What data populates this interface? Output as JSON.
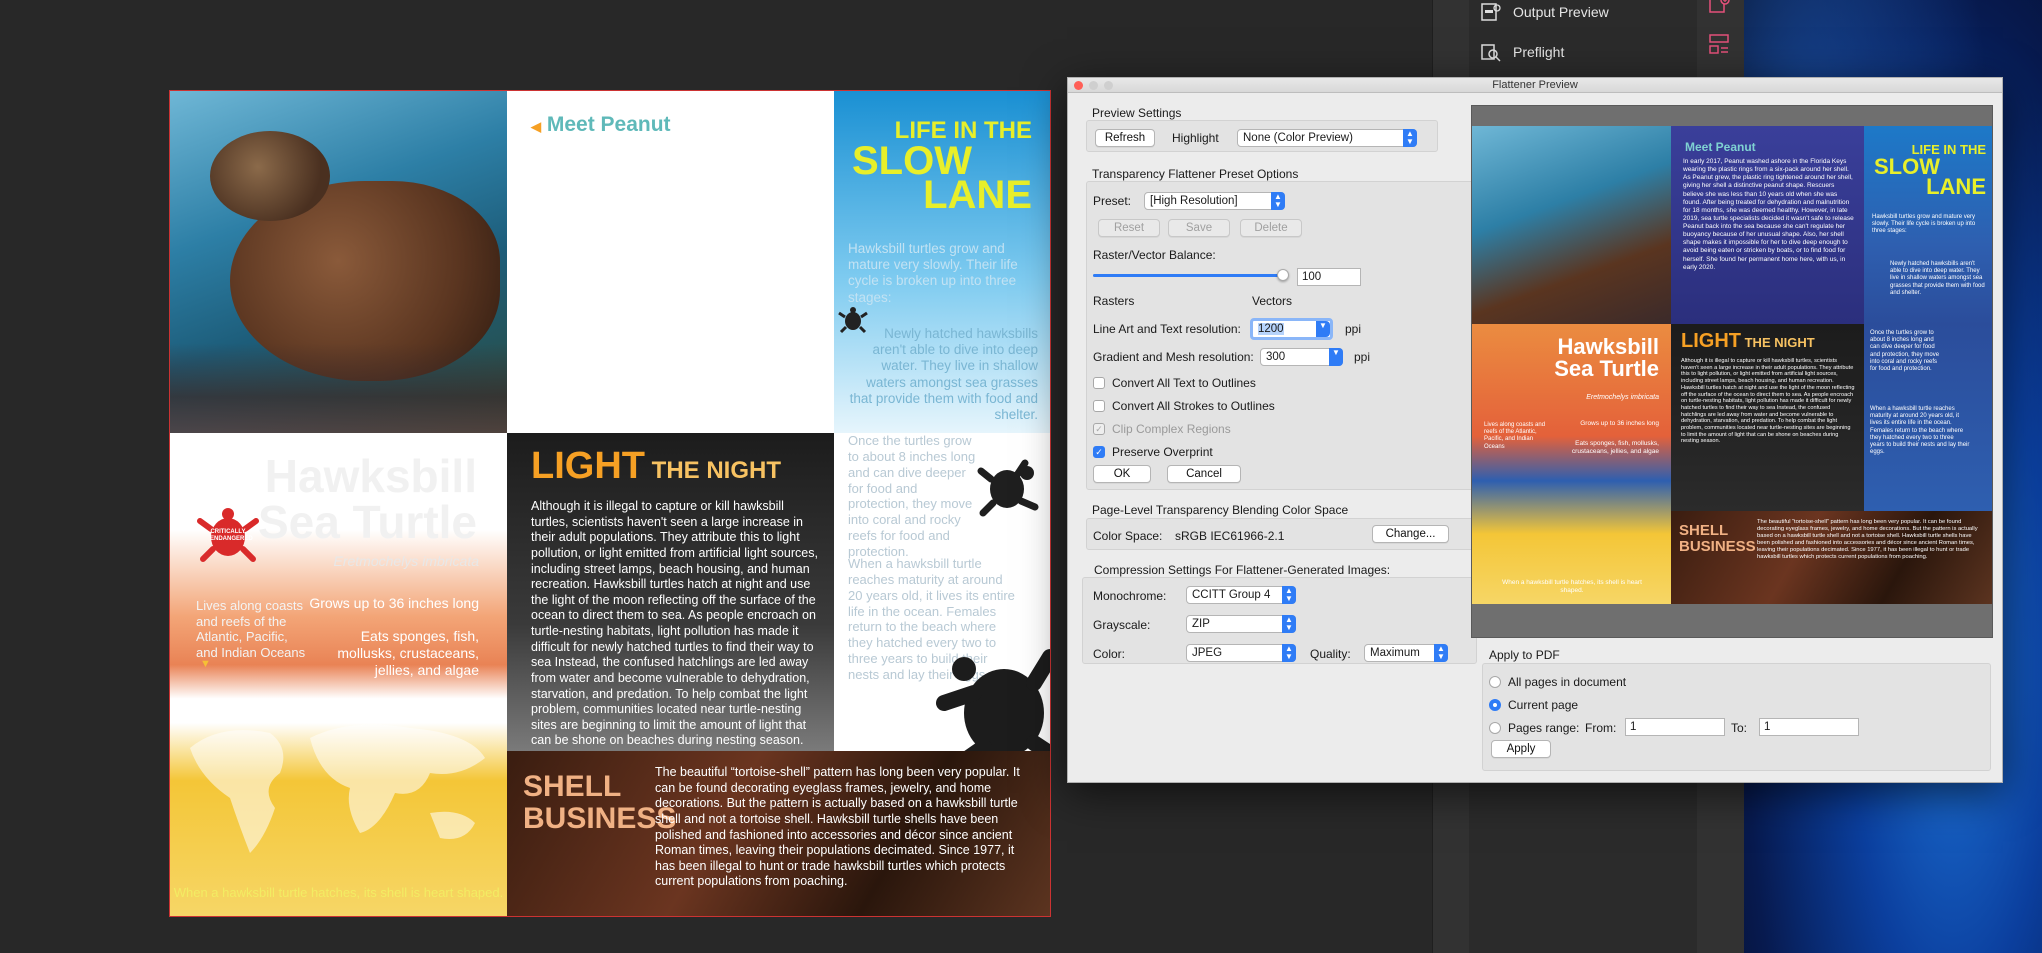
{
  "tools": {
    "output_preview": "Output Preview",
    "preflight": "Preflight"
  },
  "brochure": {
    "meet_peanut": "Meet Peanut",
    "slow_lane": {
      "line1": "LIFE IN THE",
      "line2": "SLOW",
      "line3": "LANE"
    },
    "slow_p1": "Hawksbill turtles grow and mature very slowly. Their life cycle is broken up into three stages:",
    "slow_p2": "Newly hatched hawksbills aren't able to dive into deep water. They live in shallow waters amongst sea grasses that provide them with food and shelter.",
    "hawksbill_title_1": "Hawksbill",
    "hawksbill_title_2": "Sea Turtle",
    "latin": "Eretmochelys imbricata",
    "critically": "CRITICALLY ENDANGERED",
    "fact_lives": "Lives along coasts and reefs of the Atlantic, Pacific, and Indian Oceans",
    "fact_grows": "Grows up to 36 inches long",
    "fact_eats": "Eats sponges, fish, mollusks, crustaceans, jellies, and algae",
    "hatches": "When a hawksbill turtle hatches, its shell is heart shaped.",
    "light_big": "LIGHT",
    "light_small": " THE NIGHT",
    "light_p": "Although it is illegal to capture or kill hawksbill turtles, scientists haven't seen a large increase in their adult populations. They attribute this to light pollution, or light emitted from artificial light sources, including street lamps, beach housing, and human recreation. Hawksbill turtles hatch at night and use the light of the moon reflecting off the surface of the ocean to direct them to sea. As people encroach on turtle-nesting habitats, light pollution has made it difficult for newly hatched turtles to find their way to sea Instead, the confused hatchlings are led away from water and become vulnerable to dehydration, starvation, and predation. To help combat the light problem, communities located near turtle-nesting sites are beginning to limit the amount of light that can be shone on beaches during nesting season.",
    "grow_p1": "Once the turtles grow to about 8 inches long and can dive deeper for food and protection, they move into coral and rocky reefs for food and protection.",
    "grow_p2": "When a hawksbill turtle reaches maturity at around 20 years old, it lives its entire life in the ocean. Females return to the beach where they hatched every two to three years to build their nests and lay their eggs.",
    "shell_h1": "SHELL",
    "shell_h2": "BUSINESS",
    "shell_p": "The beautiful “tortoise-shell” pattern has long been very popular. It can be found decorating eyeglass frames, jewelry, and home decorations. But the pattern is actually based on a hawksbill turtle shell and not a tortoise shell. Hawksbill turtle shells have been polished and fashioned into accessories and décor since ancient Roman times, leaving their populations decimated. Since 1977, it has been illegal to hunt or trade hawksbill turtles which protects current populations from poaching.",
    "peanut_story": "In early 2017, Peanut washed ashore in the Florida Keys wearing the plastic rings from a six-pack around her shell. As Peanut grew, the plastic ring tightened around her shell, giving her shell a distinctive peanut shape. Rescuers believe she was less than 10 years old when she was found. After being treated for dehydration and malnutrition for 18 months, she was deemed healthy. However, in late 2019, sea turtle specialists decided it wasn't safe to release Peanut back into the sea because she can't regulate her buoyancy because of her unusual shape. Also, her shell shape makes it impossible for her to dive deep enough to avoid being eaten or stricken by boats, or to find food for herself. She found her permanent home here, with us, in early 2020."
  },
  "dialog": {
    "title": "Flattener Preview",
    "preview_settings": "Preview Settings",
    "refresh": "Refresh",
    "highlight_label": "Highlight",
    "highlight_value": "None (Color Preview)",
    "preset_section": "Transparency Flattener Preset Options",
    "preset_label": "Preset:",
    "preset_value": "[High Resolution]",
    "reset": "Reset",
    "save": "Save",
    "delete": "Delete",
    "balance_label": "Raster/Vector Balance:",
    "balance_value": "100",
    "balance_fraction": 1.0,
    "rasters": "Rasters",
    "vectors": "Vectors",
    "line_art_label": "Line Art and Text resolution:",
    "line_art_value": "1200",
    "gradient_label": "Gradient and Mesh resolution:",
    "gradient_value": "300",
    "ppi": "ppi",
    "cb_text": "Convert All Text to Outlines",
    "cb_strokes": "Convert All Strokes to Outlines",
    "cb_clip": "Clip Complex Regions",
    "cb_overprint": "Preserve Overprint",
    "ok": "OK",
    "cancel": "Cancel",
    "blend_section": "Page-Level Transparency Blending Color Space",
    "color_space_label": "Color Space:",
    "color_space_value": "sRGB IEC61966-2.1",
    "change": "Change...",
    "compression_section": "Compression Settings For Flattener-Generated Images:",
    "mono_label": "Monochrome:",
    "mono_value": "CCITT Group 4",
    "gray_label": "Grayscale:",
    "gray_value": "ZIP",
    "color_label": "Color:",
    "color_value": "JPEG",
    "quality_label": "Quality:",
    "quality_value": "Maximum",
    "apply_section": "Apply to PDF",
    "all_pages": "All pages in document",
    "current_page": "Current page",
    "pages_range": "Pages range:",
    "from_label": "From:",
    "from_value": "1",
    "to_label": "To:",
    "to_value": "1",
    "apply": "Apply"
  },
  "colors": {
    "accent": "#2f7cf6",
    "meet_title": "#5fb9b9",
    "slow_title": "#e8ef2a",
    "light_title": "#f6a024",
    "shell_title": "#f0b184"
  }
}
